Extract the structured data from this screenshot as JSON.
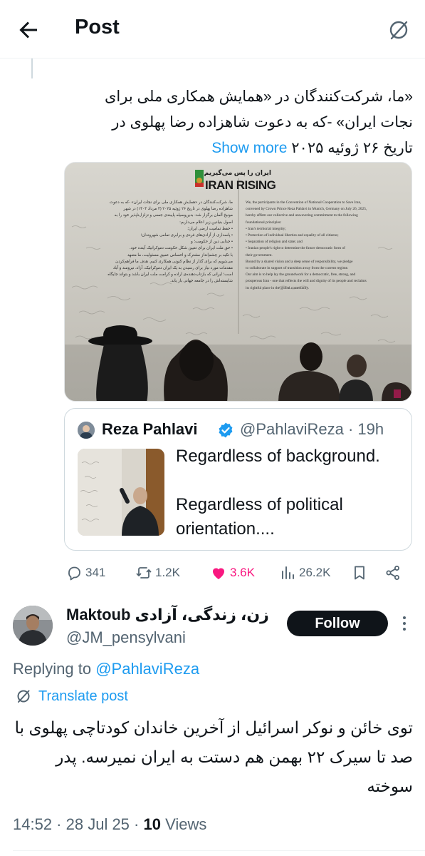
{
  "header": {
    "title": "Post"
  },
  "tweet": {
    "text": "«ما، شرکت‌کنندگان در «همایش همکاری ملی برای نجات ایران» -که به دعوت شاهزاده رضا پهلوی در تاریخ ۲۶ ژوئیه ۲۰۲۵",
    "show_more": "Show more"
  },
  "image": {
    "banner_fa": "ایران را پس می‌گیریم",
    "banner_en": "IRAN RISING",
    "english_lines": [
      "We, the participants in the Convention of National Cooperation to Save Iran,",
      "convened by Crown Prince Reza Pahlavi in Munich, Germany on July 26, 2025,",
      "hereby affirm our collective and unwavering commitment to the following",
      "foundational principles:",
      "• Iran's territorial integrity;",
      "• Protection of individual liberties and equality of all citizens;",
      "• Separation of religion and state; and",
      "• Iranian people's right to determine the future democratic form of",
      "  their government.",
      "Bound by a shared vision and a deep sense of responsibility, we pledge",
      "to collaborate in support of transition away from the current regime.",
      "Our aim is to help lay the groundwork for a democratic, free, strong, and",
      "prosperous Iran - one that reflects the will and dignity of its people and reclaims",
      "its rightful place in the global community."
    ],
    "persian_lines": [
      "ما، شرکت‌کنندگان در «همایش همکاری ملی برای نجات ایران» -که به دعوت",
      "شاهزاده رضا پهلوی در تاریخ ۲۶ ژوئیه ۲۰۲۵ (۴ مرداد ۱۴۰۴) در شهر",
      "مونیخ آلمان برگزار شد- بدین‌وسیله پایبندی جمعی و تزلزل‌ناپذیر خود را به",
      "اصول بنیادین زیر اعلام می‌داریم:",
      "• حفظ تمامیت ارضی ایران؛",
      "• پاسداری از آزادی‌های فردی و برابری تمامی شهروندان؛",
      "• جدایی دین از حکومت؛ و",
      "• حق ملت ایران برای تعیین شکل حکومت دموکراتیک آینده خود.",
      "با تکیه بر چشم‌انداز مشترک و احساس عمیق مسئولیت، ما متعهد",
      "می‌شویم که برای گذار از نظام کنونی همکاری کنیم. هدف ما فراهم‌کردن",
      "مقدمات مورد نیاز برای رسیدن به یک ایران دموکراتیک، آزاد، نیرومند و آباد",
      "است؛ ایرانی که بازتاب‌دهنده‌ی اراده و کرامت ملت ایران باشد و بتواند جایگاه",
      "شایسته‌اش را در جامعه جهانی باز یابد."
    ]
  },
  "quote": {
    "name": "Reza Pahlavi",
    "handle": "@PahlaviReza",
    "time": "19h",
    "line1": "Regardless of background.",
    "line2": "Regardless of political orientation...."
  },
  "actions": {
    "replies": "341",
    "reposts": "1.2K",
    "likes": "3.6K",
    "views": "26.2K",
    "colors": {
      "like": "#f91880",
      "muted": "#536471"
    }
  },
  "reply": {
    "name_fa": "زن، زندگی، آزادی",
    "name_en": "Maktoub",
    "handle": "@JM_pensylvani",
    "follow_label": "Follow",
    "replying_prefix": "Replying to",
    "replying_handle": "@PahlaviReza",
    "translate_label": "Translate post",
    "text": "توی خائن و نوکر اسرائیل از آخرین خاندان کودتاچی پهلوی با صد تا سیرک ۲۲ بهمن هم دستت به ایران نمیرسه. پدر سوخته",
    "time": "14:52",
    "date": "28 Jul 25",
    "views_count": "10",
    "views_label": "Views"
  },
  "colors": {
    "accent": "#1d9bf0",
    "text": "#0f1419",
    "secondary": "#536471",
    "border": "#cfd9de"
  }
}
